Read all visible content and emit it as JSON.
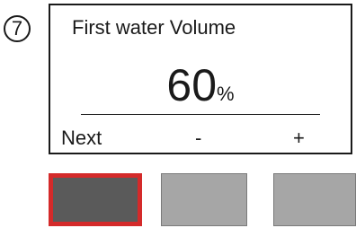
{
  "step": {
    "number": "7"
  },
  "screen": {
    "title": "First water Volume",
    "value": "60",
    "unit": "%"
  },
  "softkeys": {
    "next": "Next",
    "minus": "-",
    "plus": "+"
  },
  "hardware_buttons": [
    {
      "name": "button-1",
      "highlighted": true,
      "color": "#5a5a5a",
      "highlight_color": "#d42a2a"
    },
    {
      "name": "button-2",
      "highlighted": false,
      "color": "#a6a6a6"
    },
    {
      "name": "button-3",
      "highlighted": false,
      "color": "#a6a6a6"
    }
  ]
}
